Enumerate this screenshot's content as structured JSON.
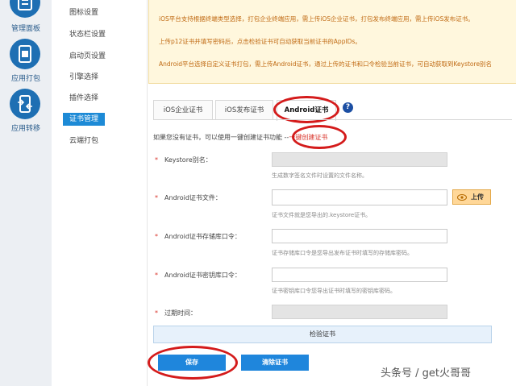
{
  "sidebar": {
    "items": [
      {
        "label": "管理面板",
        "icon": "dashboard-icon"
      },
      {
        "label": "应用打包",
        "icon": "package-icon"
      },
      {
        "label": "应用转移",
        "icon": "transfer-icon"
      }
    ]
  },
  "subnav": {
    "items": [
      {
        "label": "图标设置"
      },
      {
        "label": "状态栏设置"
      },
      {
        "label": "启动页设置"
      },
      {
        "label": "引擎选择"
      },
      {
        "label": "插件选择"
      },
      {
        "label": "证书管理"
      },
      {
        "label": "云端打包"
      }
    ],
    "active_index": 5
  },
  "notice": {
    "line1": "iOS平台支持根据终端类型选择，打包企业终端应用，需上传iOS企业证书，打包发布终端应用，需上传iOS发布证书。",
    "line2": "上传p12证书并填写密码后，点击检验证书可自动获取当前证书的AppIDs。",
    "line3": "Android平台选择自定义证书打包，需上传Android证书，通过上传的证书和口令检验当前证书，可自动获取到Keystore别名"
  },
  "tabs": [
    {
      "label": "iOS企业证书"
    },
    {
      "label": "iOS发布证书"
    },
    {
      "label": "Android证书"
    }
  ],
  "help_icon": "?",
  "intro": {
    "text": "如果您没有证书，可以使用一键创建证书功能 --",
    "link": "一键创建证书"
  },
  "form": {
    "required_mark": "*",
    "keystore_alias": {
      "label": "Keystore别名：",
      "hint": "生成数字签名文件时设置的文件名称。"
    },
    "cert_file": {
      "label": "Android证书文件：",
      "hint": "证书文件就是您导出的.keystore证书。",
      "upload_label": "上传"
    },
    "store_password": {
      "label": "Android证书存储库口令：",
      "hint": "证书存储库口令是您导出发布证书时填写的存储库密码。"
    },
    "key_password": {
      "label": "Android证书密钥库口令：",
      "hint": "证书密钥库口令您导出证书时填写的密钥库密码。"
    },
    "expiry": {
      "label": "过期时间："
    }
  },
  "verify_label": "检验证书",
  "buttons": {
    "save": "保存",
    "clear": "清除证书"
  },
  "watermark": "头条号 / get火哥哥",
  "colors": {
    "accent": "#1f86dc",
    "notice_bg": "#fff7dd",
    "highlight_ring": "#d41b1b"
  }
}
